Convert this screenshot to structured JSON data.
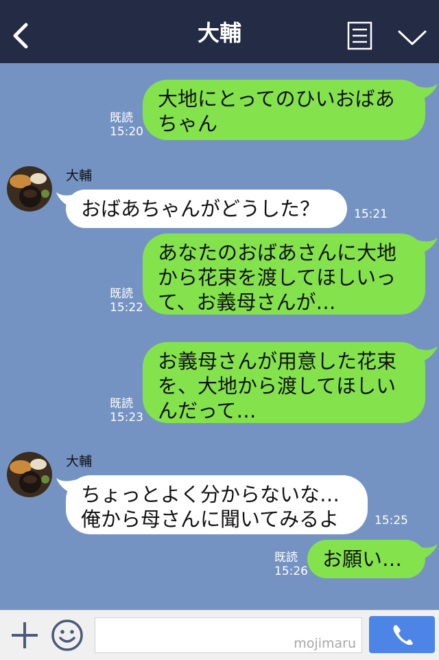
{
  "header": {
    "title": "大輔",
    "back_icon": "chevron-left-icon",
    "menu_icon": "list-menu-icon",
    "collapse_icon": "chevron-down-icon",
    "background": "#232b45"
  },
  "messages": [
    {
      "side": "me",
      "lines": [
        "大地にとってのひいおばあ",
        "ちゃん"
      ],
      "read": "既読",
      "time": "15:20"
    },
    {
      "side": "them",
      "sender": "大輔",
      "lines": [
        "おばあちゃんがどうした？"
      ],
      "time": "15:21"
    },
    {
      "side": "me",
      "lines": [
        "あなたのおばあさんに大地",
        "から花束を渡してほしいっ",
        "て、お義母さんが…"
      ],
      "read": "既読",
      "time": "15:22"
    },
    {
      "side": "me",
      "lines": [
        "お義母さんが用意した花束",
        "を、大地から渡してほしい",
        "んだって…"
      ],
      "read": "既読",
      "time": "15:23"
    },
    {
      "side": "them",
      "sender": "大輔",
      "lines": [
        "ちょっとよく分からないな…",
        "俺から母さんに聞いてみるよ"
      ],
      "time": "15:25"
    },
    {
      "side": "me",
      "lines": [
        "お願い…"
      ],
      "read": "既読",
      "time": "15:26"
    }
  ],
  "footer": {
    "plus_icon": "plus-icon",
    "sticker_icon": "smile-icon",
    "input_value": "",
    "watermark": "mojimaru",
    "call_icon": "phone-icon"
  },
  "colors": {
    "chat_background": "#7493c3",
    "my_bubble": "#84e24c",
    "their_bubble": "#ffffff",
    "call_button": "#4d85e6"
  }
}
